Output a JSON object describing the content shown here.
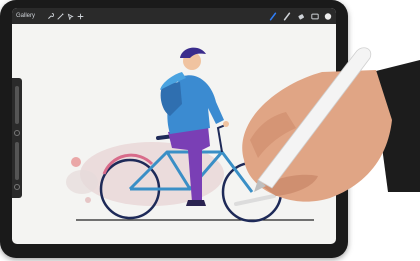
{
  "app": {
    "gallery_label": "Gallery",
    "toolbar_icons": [
      "wrench-icon",
      "magic-wand-icon",
      "selection-icon",
      "transform-icon",
      "brush-icon",
      "smudge-icon",
      "eraser-icon",
      "layers-icon",
      "color-swatch-icon"
    ]
  },
  "colors": {
    "accent": "#2f7df6",
    "bicycle": "#3a8fc6",
    "jacket": "#3b8bd1",
    "trousers": "#7a3fb5",
    "hair": "#3a2c8c",
    "skin": "#f0c3a0",
    "backdrop_blob": "#e9d6d6",
    "pencil": "#f4f4f4"
  }
}
